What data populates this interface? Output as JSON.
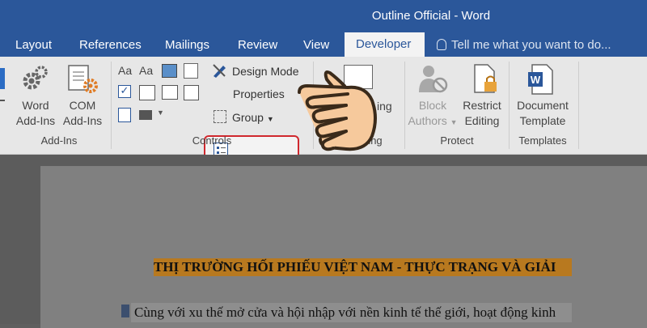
{
  "window": {
    "title": "Outline Official - Word"
  },
  "tabs": [
    {
      "label": "Layout"
    },
    {
      "label": "References"
    },
    {
      "label": "Mailings"
    },
    {
      "label": "Review"
    },
    {
      "label": "View"
    },
    {
      "label": "Developer",
      "active": true
    }
  ],
  "tell_me": {
    "placeholder": "Tell me what you want to do..."
  },
  "ribbon": {
    "addins": {
      "label": "Add-Ins",
      "word_addins": {
        "line1": "Word",
        "line2": "Add-Ins"
      },
      "com_addins": {
        "line1": "COM",
        "line2": "Add-Ins"
      }
    },
    "controls": {
      "label": "Controls",
      "design_mode": "Design Mode",
      "properties": "Properties",
      "group": "Group"
    },
    "mapping": {
      "partial_label": "ing",
      "partial_button": "ing"
    },
    "protect": {
      "label": "Protect",
      "block_authors": {
        "line1": "Block",
        "line2": "Authors"
      },
      "restrict_editing": {
        "line1": "Restrict",
        "line2": "Editing"
      }
    },
    "templates": {
      "label": "Templates",
      "document_template": {
        "line1": "Document",
        "line2": "Template"
      }
    }
  },
  "document": {
    "heading": "THỊ TRƯỜNG HỐI PHIẾU VIỆT NAM - THỰC TRẠNG VÀ GIẢI",
    "body_line": "Cùng với xu thế mở cửa và hội nhập với nền kinh tế thế giới, hoạt động kinh"
  },
  "colors": {
    "title_bar": "#2b579a",
    "ribbon": "#e7e7e7",
    "highlight": "#d0282e",
    "heading_highlight": "#b8791f",
    "hand_fill": "#f6c99c"
  }
}
